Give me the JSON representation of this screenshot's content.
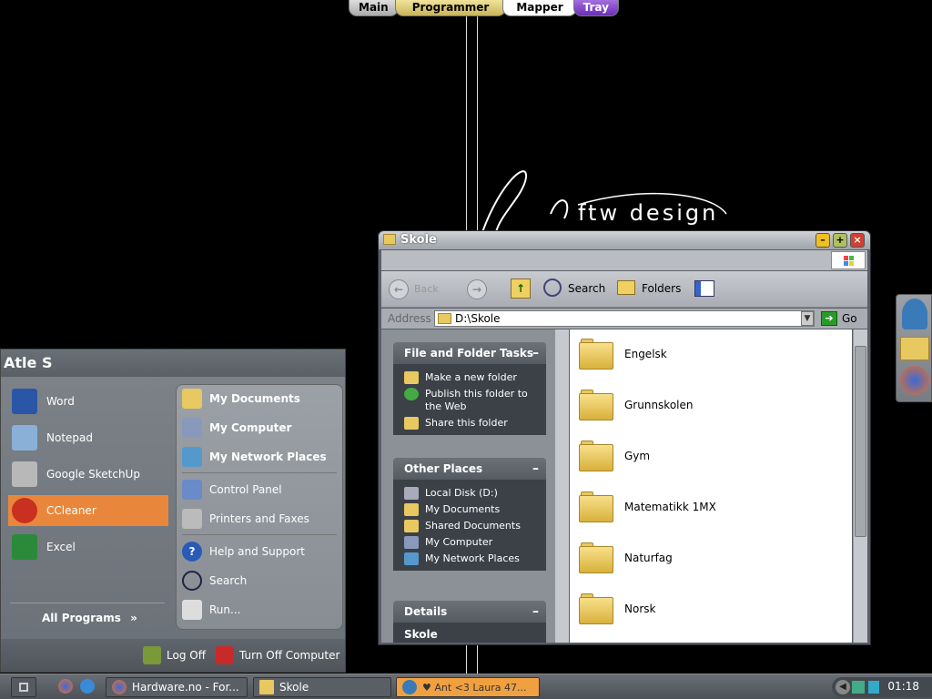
{
  "top_dock": {
    "tabs": [
      "Main",
      "Programmer",
      "Mapper",
      "Tray"
    ]
  },
  "logo": {
    "text": "ftw design"
  },
  "explorer": {
    "title": "Skole",
    "toolbar": {
      "back": "Back",
      "search": "Search",
      "folders": "Folders"
    },
    "address": {
      "label": "Address",
      "value": "D:\\Skole",
      "go": "Go"
    },
    "tasks_panel": {
      "title": "File and Folder Tasks",
      "items": [
        "Make a new folder",
        "Publish this folder to the Web",
        "Share this folder"
      ]
    },
    "other_places": {
      "title": "Other Places",
      "items": [
        "Local Disk (D:)",
        "My Documents",
        "Shared Documents",
        "My Computer",
        "My Network Places"
      ]
    },
    "details": {
      "title": "Details",
      "name": "Skole"
    },
    "folders": [
      "Engelsk",
      "Grunnskolen",
      "Gym",
      "Matematikk 1MX",
      "Naturfag",
      "Norsk"
    ]
  },
  "start_menu": {
    "user": "Atle S",
    "pinned": [
      "Word",
      "Notepad",
      "Google SketchUp",
      "CCleaner",
      "Excel"
    ],
    "selected": "CCleaner",
    "all_programs": "All Programs",
    "right": [
      "My Documents",
      "My Computer",
      "My Network Places",
      "Control Panel",
      "Printers and Faxes",
      "Help and Support",
      "Search",
      "Run..."
    ],
    "log_off": "Log Off",
    "turn_off": "Turn Off Computer"
  },
  "taskbar": {
    "tasks": [
      "Hardware.no - For...",
      "Skole",
      "♥ Ant <3 Laura 47..."
    ],
    "clock": "01:18"
  },
  "colors": {
    "accent": "#e8873c",
    "selected_task": "#f0a040"
  }
}
